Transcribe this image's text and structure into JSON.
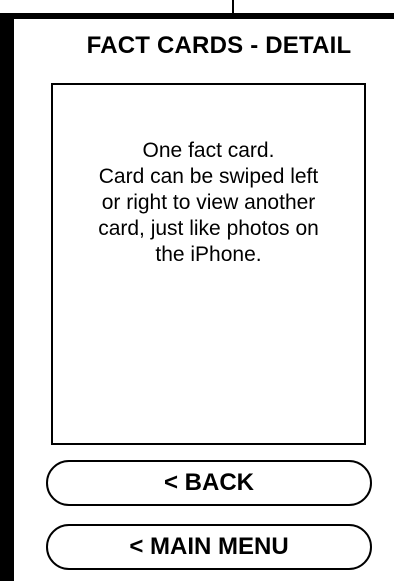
{
  "header": {
    "title": "FACT CARDS - DETAIL"
  },
  "card": {
    "lines": [
      "One fact card.",
      "Card can be swiped left",
      "or right to view another",
      "card, just like photos on",
      "the iPhone."
    ]
  },
  "buttons": {
    "back_label": "< BACK",
    "main_menu_label": "< MAIN MENU"
  },
  "colors": {
    "ink": "#000000",
    "background": "#ffffff"
  }
}
